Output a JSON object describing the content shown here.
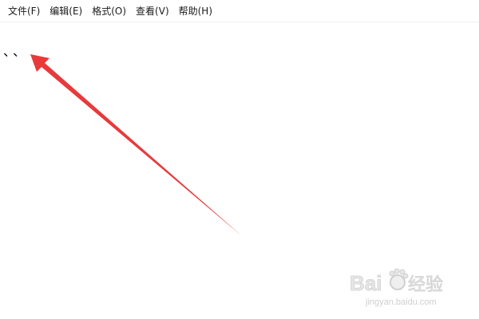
{
  "menubar": {
    "items": [
      {
        "label": "文件(F)"
      },
      {
        "label": "编辑(E)"
      },
      {
        "label": "格式(O)"
      },
      {
        "label": "查看(V)"
      },
      {
        "label": "帮助(H)"
      }
    ]
  },
  "editor": {
    "content": "、、"
  },
  "annotation": {
    "icon": "arrow-icon",
    "color": "#e8393b"
  },
  "watermark": {
    "brand": "Bai du 经验",
    "url": "jingyan.baidu.com"
  }
}
